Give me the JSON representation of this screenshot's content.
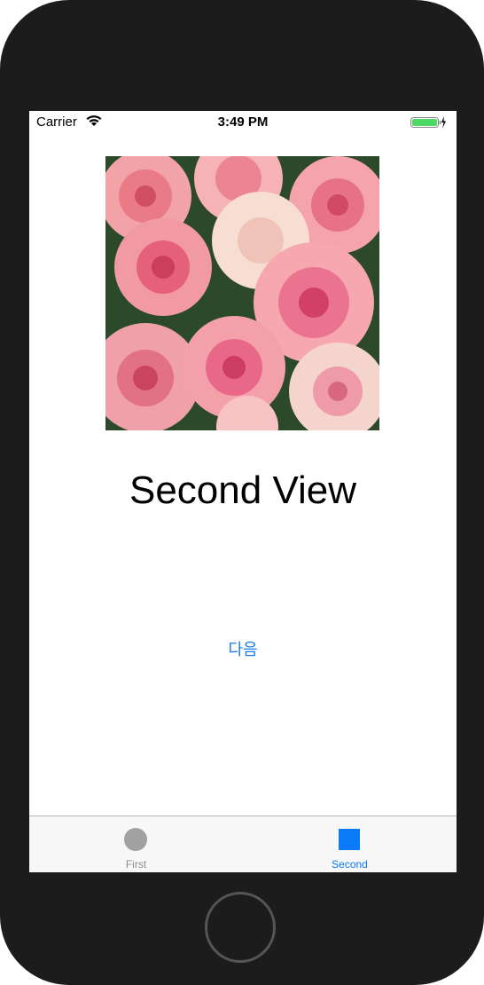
{
  "status_bar": {
    "carrier": "Carrier",
    "time": "3:49 PM",
    "wifi_icon": "wifi-icon",
    "battery_icon": "battery-charging-icon",
    "battery_color": "#4cd964"
  },
  "main": {
    "image": {
      "description_icon": "rose-photo"
    },
    "title": "Second View",
    "next_button_label": "다음"
  },
  "tab_bar": {
    "tabs": [
      {
        "label": "First",
        "icon": "circle-icon",
        "selected": false
      },
      {
        "label": "Second",
        "icon": "square-icon",
        "selected": true
      }
    ]
  },
  "colors": {
    "accent": "#0b7bf7",
    "link": "#1a7ee6",
    "device_frame": "#1c1c1c"
  }
}
